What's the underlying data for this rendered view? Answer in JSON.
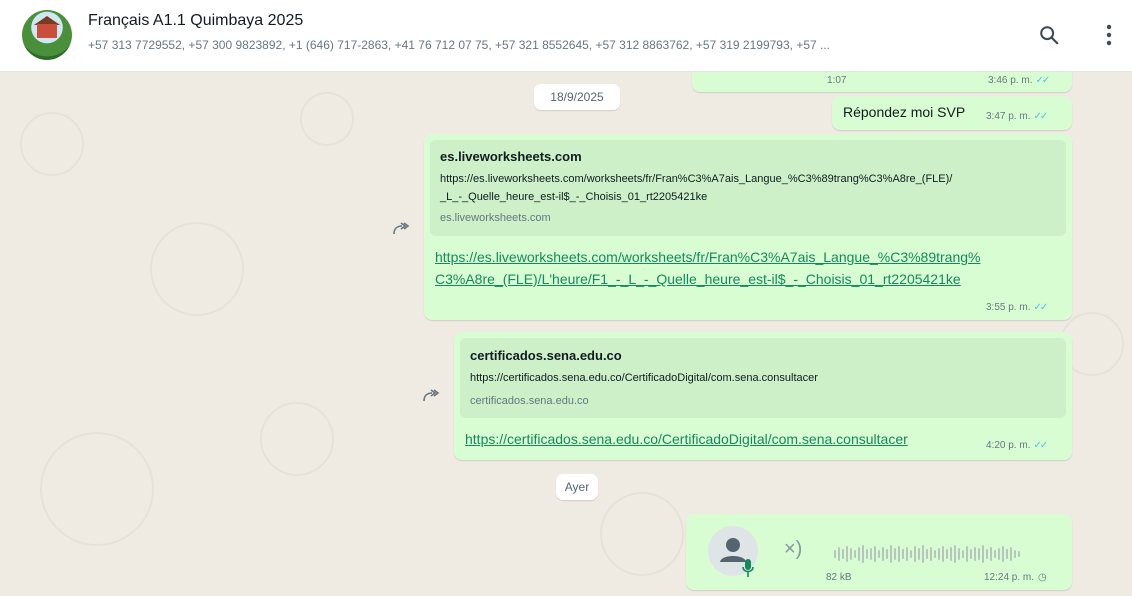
{
  "header": {
    "title": "Français A1.1 Quimbaya 2025",
    "participants": "+57 313 7729552, +57 300 9823892, +1 (646) 717-2863, +41 76 712 07 75, +57 321 8552645, +57 312 8863762, +57 319 2199793, +57 ...",
    "search_icon": "search-icon",
    "menu_icon": "kebab-menu-icon"
  },
  "chat": {
    "top_partial": {
      "duration": "1:07",
      "time": "3:46 p. m."
    },
    "date1": "18/9/2025",
    "msg1": {
      "text": "Répondez moi SVP",
      "time": "3:47 p. m."
    },
    "msg2": {
      "preview_title": "es.liveworksheets.com",
      "preview_url_line1": "https://es.liveworksheets.com/worksheets/fr/Fran%C3%A7ais_Langue_%C3%89trang%C3%A8re_(FLE)/",
      "preview_url_line2": "_L_-_Quelle_heure_est-il$_-_Choisis_01_rt2205421ke",
      "preview_domain": "es.liveworksheets.com",
      "link_line1": "https://es.liveworksheets.com/worksheets/fr/Fran%C3%A7ais_Langue_%C3%89trang%",
      "link_line2": "C3%A8re_(FLE)/L'heure/F1_-_L_-_Quelle_heure_est-il$_-_Choisis_01_rt2205421ke",
      "time": "3:55 p. m."
    },
    "msg3": {
      "preview_title": "certificados.sena.edu.co",
      "preview_url": "https://certificados.sena.edu.co/CertificadoDigital/com.sena.consultacer",
      "preview_domain": "certificados.sena.edu.co",
      "link": "https://certificados.sena.edu.co/CertificadoDigital/com.sena.consultacer",
      "time": "4:20 p. m."
    },
    "date2": "Ayer",
    "voice": {
      "size": "82 kB",
      "time": "12:24 p. m."
    }
  },
  "colors": {
    "bubble": "#d9fdd3",
    "wallpaper": "#efeae2",
    "link": "#15895d",
    "ticks": "#53bdeb"
  }
}
